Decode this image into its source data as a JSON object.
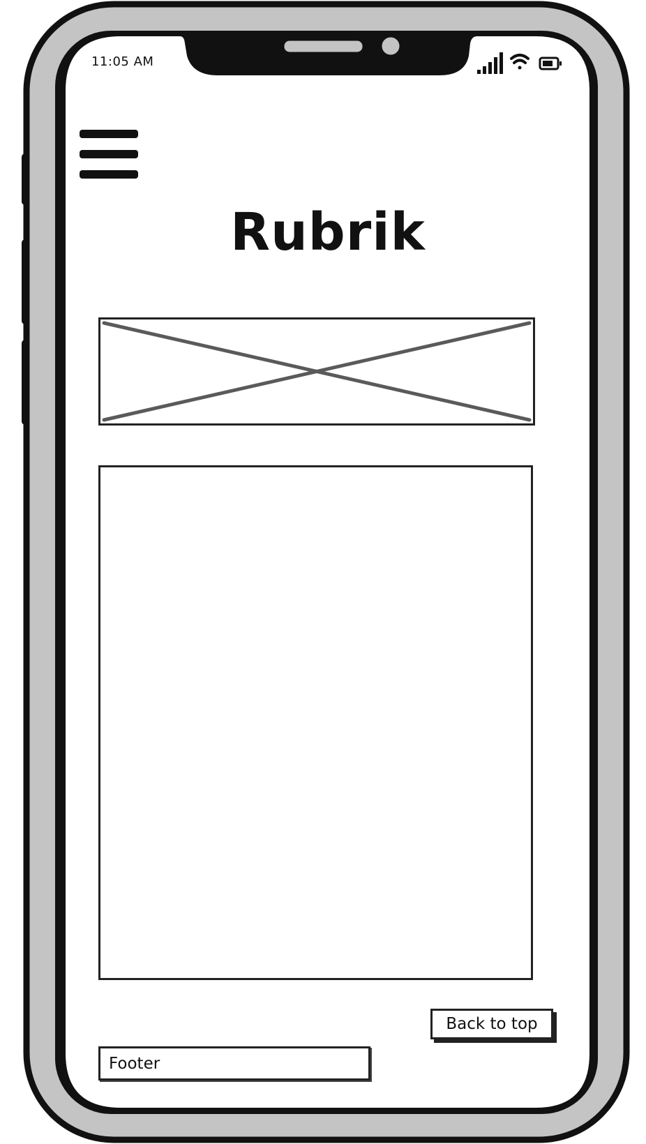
{
  "status_bar": {
    "time": "11:05 AM",
    "icons": [
      "signal-bars-icon",
      "wifi-icon",
      "battery-icon"
    ]
  },
  "header": {
    "menu_icon": "hamburger-menu-icon",
    "title": "Rubrik"
  },
  "main": {
    "image_placeholder_icon": "image-placeholder-x"
  },
  "footer": {
    "back_to_top_label": "Back to top",
    "footer_label": "Footer"
  },
  "colors": {
    "frame_fill": "#c4c4c4",
    "outline": "#111111",
    "screen": "#ffffff",
    "placeholder_cross": "#5a5a5a"
  }
}
